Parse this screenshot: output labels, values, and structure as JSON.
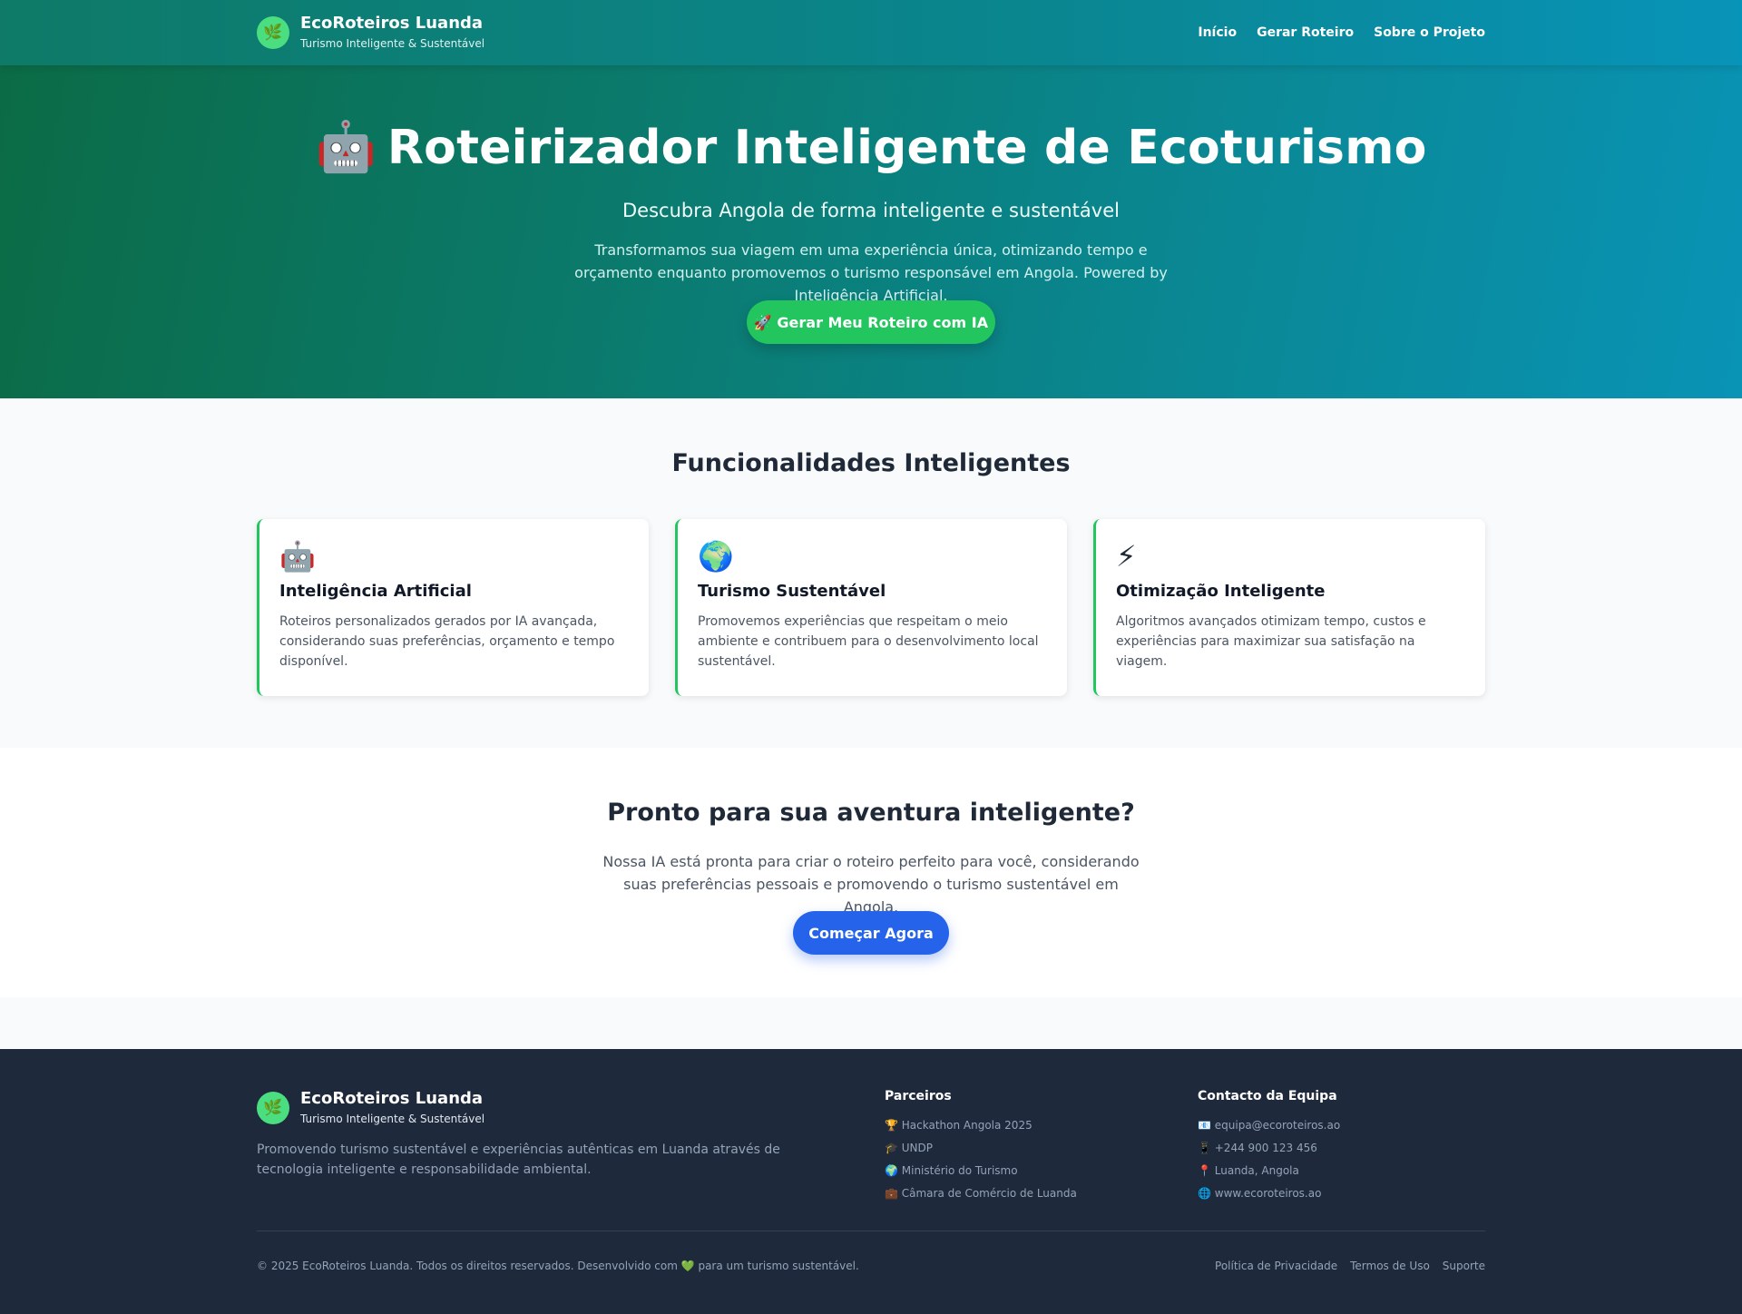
{
  "header": {
    "brand_title": "EcoRoteiros Luanda",
    "brand_subtitle": "Turismo Inteligente & Sustentável",
    "logo_icon": "leaf-icon",
    "nav": [
      {
        "label": "Início"
      },
      {
        "label": "Gerar Roteiro"
      },
      {
        "label": "Sobre o Projeto"
      }
    ]
  },
  "hero": {
    "emoji": "🤖",
    "title": "Roteirizador Inteligente de Ecoturismo",
    "tagline": "Descubra Angola de forma inteligente e sustentável",
    "description": "Transformamos sua viagem em uma experiência única, otimizando tempo e orçamento enquanto promovemos o turismo responsável em Angola. Powered by Inteligência Artificial.",
    "cta_label": "🚀 Gerar Meu Roteiro com IA"
  },
  "features": {
    "heading": "Funcionalidades Inteligentes",
    "cards": [
      {
        "icon": "🤖",
        "icon_name": "robot-icon",
        "title": "Inteligência Artificial",
        "text": "Roteiros personalizados gerados por IA avançada, considerando suas preferências, orçamento e tempo disponível."
      },
      {
        "icon": "🌍",
        "icon_name": "globe-icon",
        "title": "Turismo Sustentável",
        "text": "Promovemos experiências que respeitam o meio ambiente e contribuem para o desenvolvimento local sustentável."
      },
      {
        "icon": "⚡",
        "icon_name": "lightning-icon",
        "title": "Otimização Inteligente",
        "text": "Algoritmos avançados otimizam tempo, custos e experiências para maximizar sua satisfação na viagem."
      }
    ]
  },
  "ready": {
    "heading": "Pronto para sua aventura inteligente?",
    "text": "Nossa IA está pronta para criar o roteiro perfeito para você, considerando suas preferências pessoais e promovendo o turismo sustentável em Angola.",
    "cta_label": "Começar Agora"
  },
  "footer": {
    "brand_title": "EcoRoteiros Luanda",
    "brand_subtitle": "Turismo Inteligente & Sustentável",
    "description": "Promovendo turismo sustentável e experiências autênticas em Luanda através de tecnologia inteligente e responsabilidade ambiental.",
    "partners_heading": "Parceiros",
    "partners": [
      "🏆 Hackathon Angola 2025",
      "🎓 UNDP",
      "🌍 Ministério do Turismo",
      "💼 Câmara de Comércio de Luanda"
    ],
    "contact_heading": "Contacto da Equipa",
    "contacts": [
      "📧 equipa@ecoroteiros.ao",
      "📱 +244 900 123 456",
      "📍 Luanda, Angola",
      "🌐 www.ecoroteiros.ao"
    ],
    "copyright": "© 2025 EcoRoteiros Luanda. Todos os direitos reservados. Desenvolvido com 💚 para um turismo sustentável.",
    "links": [
      "Política de Privacidade",
      "Termos de Uso",
      "Suporte"
    ]
  },
  "colors": {
    "primary_green": "#22c55e",
    "primary_blue": "#2563eb",
    "teal": "#0a8690",
    "footer_bg": "#1e293b"
  }
}
